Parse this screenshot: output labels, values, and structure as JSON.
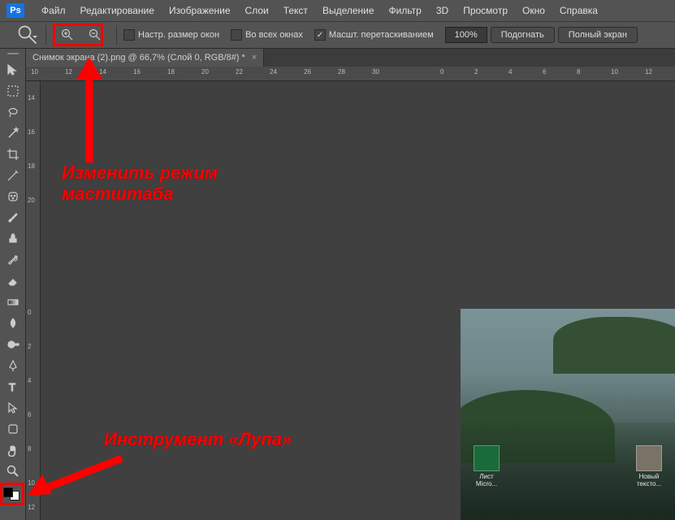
{
  "logo": "Ps",
  "menu": [
    "Файл",
    "Редактирование",
    "Изображение",
    "Слои",
    "Текст",
    "Выделение",
    "Фильтр",
    "3D",
    "Просмотр",
    "Окно",
    "Справка"
  ],
  "optbar": {
    "resize_windows": "Настр. размер окон",
    "all_windows": "Во всех окнах",
    "scrubby_zoom": "Масшт. перетаскиванием",
    "zoom_value": "100%",
    "fit": "Подогнать",
    "full": "Полный экран"
  },
  "doc_tab": {
    "title": "Снимок экрана (2).png @ 66,7% (Слой 0, RGB/8#) *"
  },
  "ruler_h": [
    "10",
    "12",
    "14",
    "16",
    "18",
    "20",
    "22",
    "24",
    "26",
    "28",
    "30",
    "0",
    "2",
    "4",
    "6",
    "8",
    "10",
    "12"
  ],
  "ruler_v": [
    "14",
    "16",
    "18",
    "20",
    "0",
    "2",
    "4",
    "6",
    "8",
    "10",
    "12"
  ],
  "annotations": {
    "zoom_mode": "Изменить режим мастштаба",
    "zoom_tool": "Инструмент «Лупа»"
  },
  "desktop": {
    "icon1": "Лист Micro...",
    "icon2": "Новый тексто..."
  }
}
